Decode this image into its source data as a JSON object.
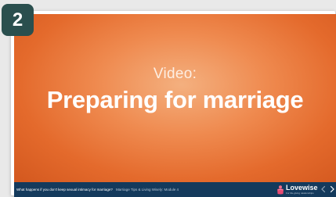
{
  "badge": {
    "number": "2"
  },
  "slide": {
    "subtitle": "Video:",
    "title": "Preparing for marriage"
  },
  "footer": {
    "question": "What happens if you don't keep sexual intimacy for marriage?",
    "source": "Marriage Tips & Living Wisely: Module 4",
    "brand_name": "Lovewise",
    "brand_tagline": "For life-giving relationships"
  },
  "icons": {
    "logo": "lovewise-logo-icon",
    "prev": "chevron-left-icon",
    "next": "chevron-right-icon"
  },
  "colors": {
    "slide_orange": "#e46a2c",
    "footer_navy": "#143a5c",
    "badge_teal": "#2a4f4e"
  }
}
